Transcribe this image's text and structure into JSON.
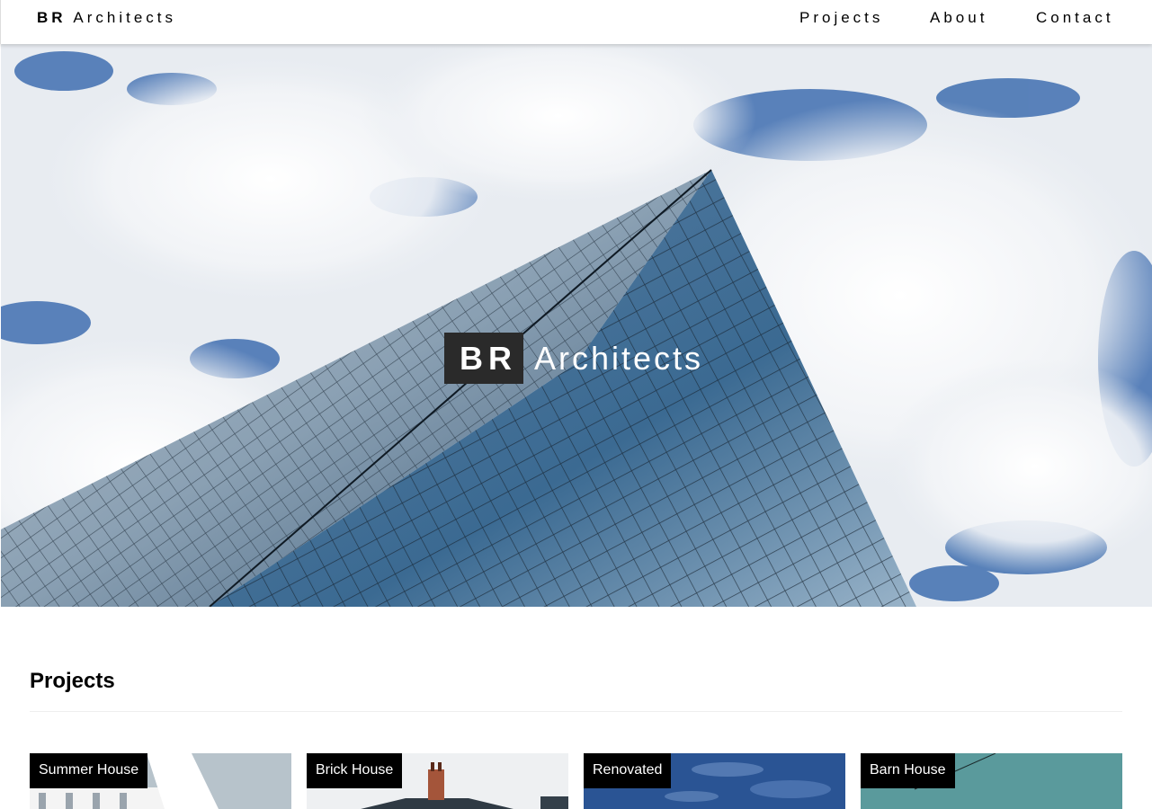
{
  "nav": {
    "brand_bold": "BR",
    "brand_rest": "Architects",
    "links": [
      "Projects",
      "About",
      "Contact"
    ]
  },
  "hero": {
    "title_bold": "BR",
    "title_rest": "Architects"
  },
  "projects": {
    "heading": "Projects",
    "cards": [
      {
        "label": "Summer House"
      },
      {
        "label": "Brick House"
      },
      {
        "label": "Renovated"
      },
      {
        "label": "Barn House"
      }
    ]
  },
  "colors": {
    "title_box": "#2a2a2a",
    "label_bg": "#000000",
    "sky": "#3f6fb0",
    "glass": "#2f5f85"
  }
}
